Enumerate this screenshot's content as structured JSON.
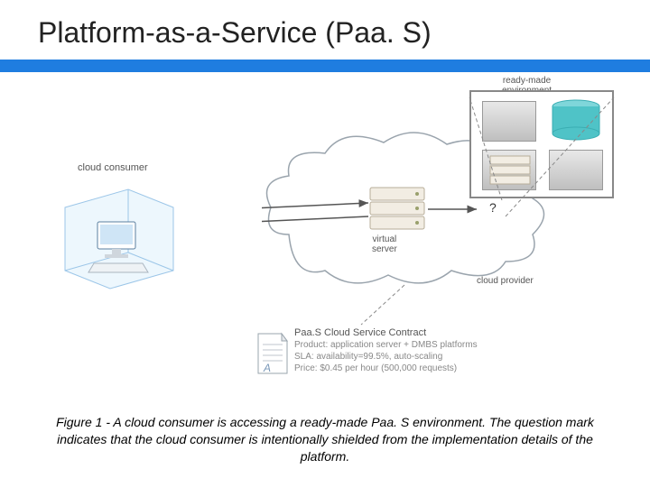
{
  "title": "Platform-as-a-Service (Paa. S)",
  "labels": {
    "consumer": "cloud consumer",
    "env": "ready-made\nenvironment",
    "virtual_server": "virtual\nserver",
    "provider": "cloud provider",
    "question": "?"
  },
  "contract": {
    "heading": "Paa.S Cloud Service Contract",
    "line1": "Product: application server + DMBS platforms",
    "line2": "SLA: availability=99.5%, auto-scaling",
    "line3": "Price: $0.45 per hour (500,000 requests)"
  },
  "caption": "Figure 1 - A cloud consumer is accessing a ready-made Paa. S environment. The question mark indicates that the cloud consumer is intentionally shielded from the implementation details of the platform.",
  "colors": {
    "accent": "#1f7de0",
    "cylinder": "#4fc3c7"
  }
}
